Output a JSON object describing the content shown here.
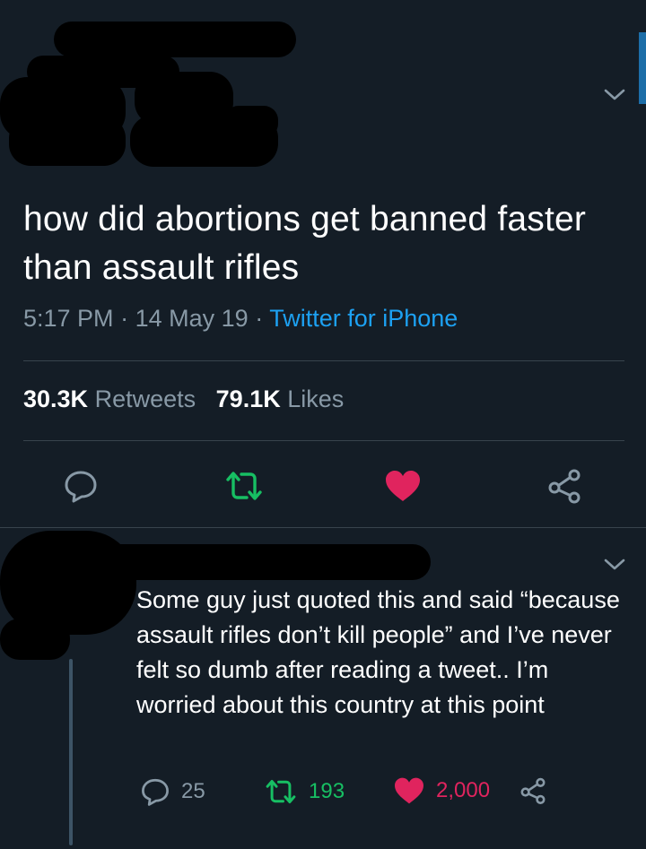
{
  "tweet": {
    "text": "how did abortions get banned faster than assault rifles",
    "time": "5:17 PM",
    "date": "14 May 19",
    "separator": "·",
    "source": "Twitter for iPhone",
    "retweets_count": "30.3K",
    "retweets_label": "Retweets",
    "likes_count": "79.1K",
    "likes_label": "Likes"
  },
  "reply": {
    "text": "Some guy just quoted this and said “because assault rifles don’t kill people” and I’ve never felt so dumb after reading a tweet.. I’m worried about this country at this point",
    "reply_count": "25",
    "retweet_count": "193",
    "like_count": "2,000"
  },
  "icons": {
    "reply": "speech-bubble-icon",
    "retweet": "retweet-arrows-icon",
    "like": "heart-icon",
    "share": "share-nodes-icon",
    "more": "chevron-down-icon"
  },
  "colors": {
    "background": "#141d26",
    "muted": "#8899a6",
    "link": "#1da1f2",
    "retweet": "#17bf63",
    "like": "#e0245e",
    "divider": "#38444d"
  }
}
